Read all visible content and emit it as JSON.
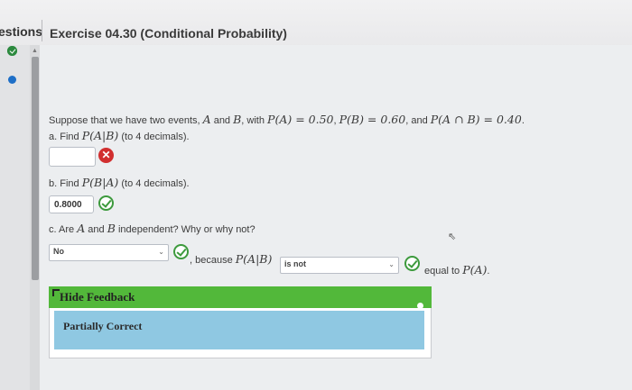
{
  "tabs": {
    "questions": "estions"
  },
  "exercise": {
    "title": "Exercise 04.30 (Conditional Probability)"
  },
  "question": {
    "intro_prefix": "Suppose that we have two events, ",
    "A": "A",
    "and": " and ",
    "B": "B",
    "intro_with": ", with ",
    "pA": "P(A) = 0.50",
    "pB": "P(B) = 0.60",
    "and_word": ", and ",
    "pAB": "P(A ∩ B) = 0.40",
    "period": "."
  },
  "part_a": {
    "label": "a.",
    "find": "Find ",
    "expr": "P(A|B)",
    "suffix": " (to 4 decimals).",
    "answer": "",
    "status": "incorrect"
  },
  "part_b": {
    "label": "b.",
    "find": "Find ",
    "expr": "P(B|A)",
    "suffix": " (to 4 decimals).",
    "answer": "0.8000",
    "status": "correct"
  },
  "part_c": {
    "label": "c.",
    "q_prefix": "Are ",
    "A": "A",
    "and": " and ",
    "B": "B",
    "q_suffix": " independent? Why or why not?",
    "select1": "No",
    "because": ", because ",
    "expr": "P(A|B)",
    "select2": "is not",
    "equal_to": "equal to ",
    "expr2": "P(A)",
    "period": "."
  },
  "feedback": {
    "toggle_label": "Hide Feedback",
    "result": "Partially Correct"
  },
  "colors": {
    "feedback_header": "#52b83a",
    "feedback_body": "#8fc8e2",
    "correct": "#3d9a3d",
    "incorrect": "#d12f2f"
  }
}
